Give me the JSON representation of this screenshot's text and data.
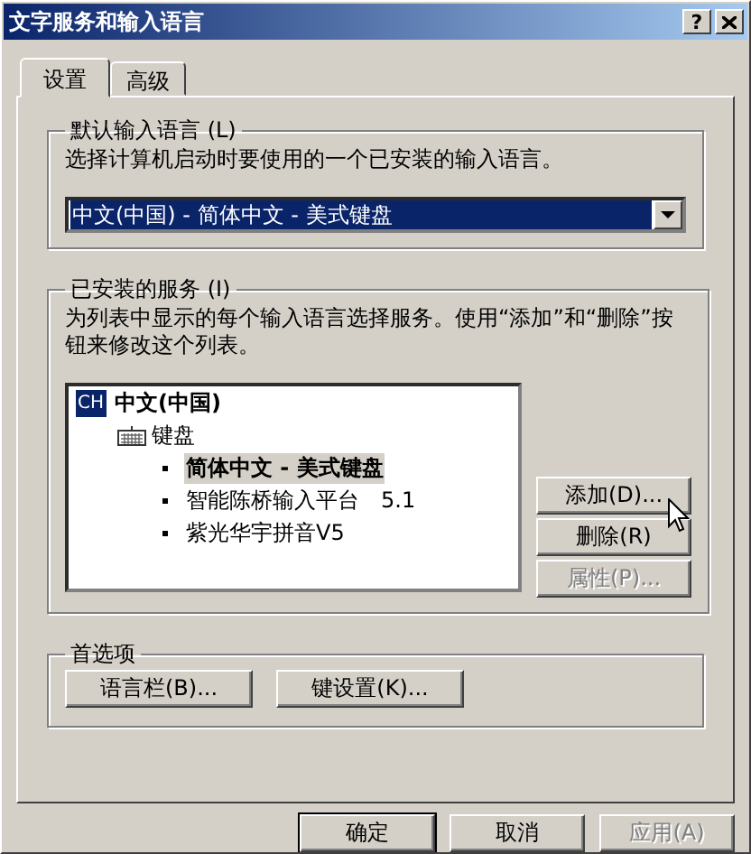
{
  "window": {
    "title": "文字服务和输入语言",
    "help_button": "?"
  },
  "tabs": [
    {
      "label": "设置",
      "selected": true
    },
    {
      "label": "高级",
      "selected": false
    }
  ],
  "default_language": {
    "legend": "默认输入语言 (L)",
    "description": "选择计算机启动时要使用的一个已安装的输入语言。",
    "value": "中文(中国) - 简体中文 - 美式键盘"
  },
  "installed_services": {
    "legend": "已安装的服务 (I)",
    "description": "为列表中显示的每个输入语言选择服务。使用“添加”和“删除”按钮来修改这个列表。",
    "tree": [
      {
        "badge": "CH",
        "label": "中文(中国)",
        "children": [
          {
            "label": "键盘",
            "children": [
              {
                "label": "简体中文 - 美式键盘",
                "selected": true
              },
              {
                "label": "智能陈桥输入平台　5.1",
                "selected": false
              },
              {
                "label": "紫光华宇拼音V5",
                "selected": false
              }
            ]
          }
        ]
      }
    ],
    "buttons": [
      {
        "label": "添加(D)...",
        "disabled": false
      },
      {
        "label": "删除(R)",
        "disabled": false
      },
      {
        "label": "属性(P)...",
        "disabled": true
      }
    ]
  },
  "preferences": {
    "legend": "首选项",
    "buttons": [
      {
        "label": "语言栏(B)..."
      },
      {
        "label": "键设置(K)..."
      }
    ]
  },
  "dialog_buttons": [
    {
      "label": "确定",
      "default": true,
      "disabled": false
    },
    {
      "label": "取消",
      "default": false,
      "disabled": false
    },
    {
      "label": "应用(A)",
      "default": false,
      "disabled": true
    }
  ]
}
